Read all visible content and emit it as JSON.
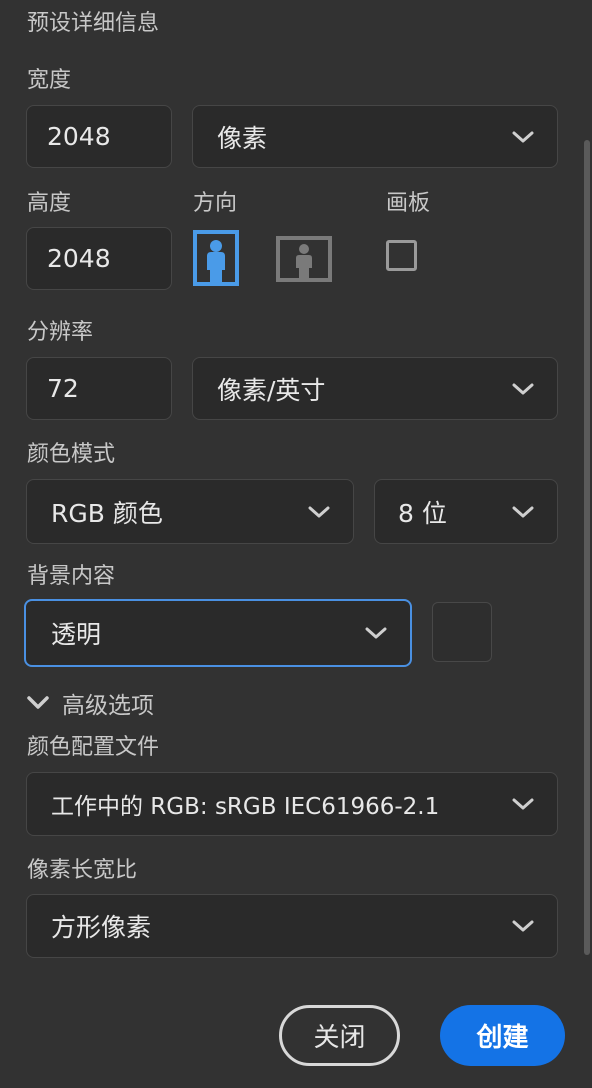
{
  "panel": {
    "title": "预设详细信息"
  },
  "width": {
    "label": "宽度",
    "value": "2048",
    "unit": "像素"
  },
  "height": {
    "label": "高度",
    "value": "2048"
  },
  "orientation": {
    "label": "方向",
    "portrait_icon": "portrait-orientation-icon",
    "landscape_icon": "landscape-orientation-icon"
  },
  "artboard": {
    "label": "画板",
    "checked": false
  },
  "resolution": {
    "label": "分辨率",
    "value": "72",
    "unit": "像素/英寸"
  },
  "color_mode": {
    "label": "颜色模式",
    "mode": "RGB 颜色",
    "bits": "8 位"
  },
  "background": {
    "label": "背景内容",
    "value": "透明"
  },
  "advanced": {
    "label": "高级选项",
    "expanded": true
  },
  "color_profile": {
    "label": "颜色配置文件",
    "value": "工作中的 RGB: sRGB IEC61966-2.1"
  },
  "pixel_aspect": {
    "label": "像素长宽比",
    "value": "方形像素"
  },
  "buttons": {
    "close": "关闭",
    "create": "创建"
  },
  "colors": {
    "accent": "#1473e6",
    "focus": "#4a90e2",
    "selected_icon": "#4a9be8",
    "background": "#323232"
  }
}
